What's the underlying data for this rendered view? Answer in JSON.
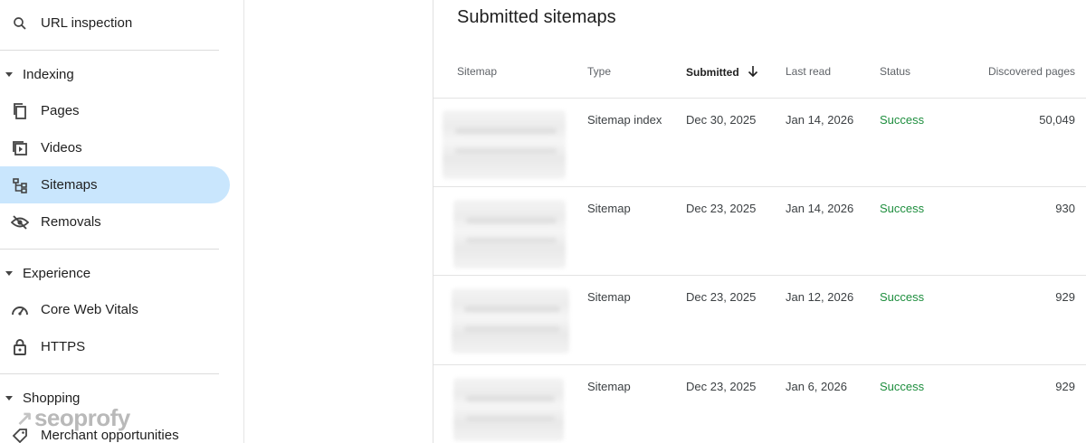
{
  "sidebar": {
    "url_inspection": "URL inspection",
    "sections": {
      "indexing": "Indexing",
      "experience": "Experience",
      "shopping": "Shopping"
    },
    "items": {
      "pages": "Pages",
      "videos": "Videos",
      "sitemaps": "Sitemaps",
      "removals": "Removals",
      "core_web_vitals": "Core Web Vitals",
      "https": "HTTPS",
      "merchant": "Merchant opportunities"
    },
    "active_item": "Sitemaps"
  },
  "watermark": "seoprofy",
  "main": {
    "title": "Submitted sitemaps",
    "columns": {
      "sitemap": "Sitemap",
      "type": "Type",
      "submitted": "Submitted",
      "last_read": "Last read",
      "status": "Status",
      "discovered": "Discovered pages"
    },
    "rows": [
      {
        "type": "Sitemap index",
        "submitted": "Dec 30, 2025",
        "last_read": "Jan 14, 2026",
        "status": "Success",
        "discovered": "50,049"
      },
      {
        "type": "Sitemap",
        "submitted": "Dec 23, 2025",
        "last_read": "Jan 14, 2026",
        "status": "Success",
        "discovered": "930"
      },
      {
        "type": "Sitemap",
        "submitted": "Dec 23, 2025",
        "last_read": "Jan 12, 2026",
        "status": "Success",
        "discovered": "929"
      },
      {
        "type": "Sitemap",
        "submitted": "Dec 23, 2025",
        "last_read": "Jan 6, 2026",
        "status": "Success",
        "discovered": "929"
      }
    ]
  },
  "colors": {
    "active_bg": "#c9e6fd",
    "success": "#1e8e3e"
  }
}
